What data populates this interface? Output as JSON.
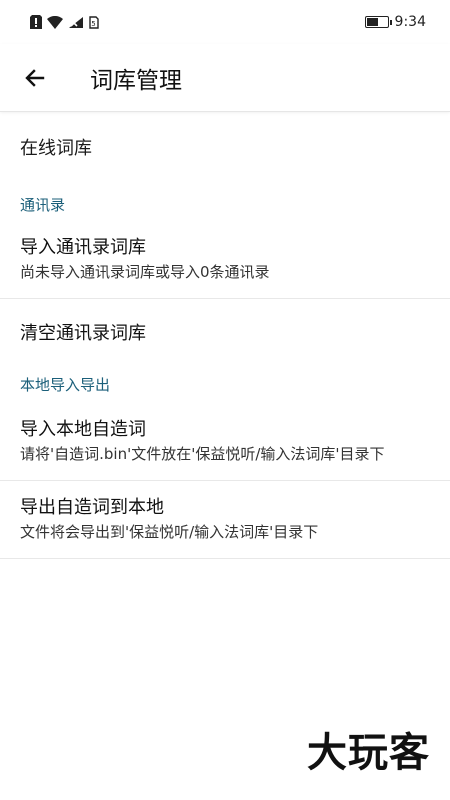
{
  "status_bar": {
    "left_icons": [
      "alert-icon",
      "wifi-icon",
      "signal-icon",
      "sim-icon"
    ],
    "time": "9:34"
  },
  "app_bar": {
    "title": "词库管理"
  },
  "online": {
    "label": "在线词库"
  },
  "contacts_section": {
    "header": "通讯录",
    "import": {
      "title": "导入通讯录词库",
      "subtitle": "尚未导入通讯录词库或导入0条通讯录"
    },
    "clear": {
      "title": "清空通讯录词库"
    }
  },
  "local_section": {
    "header": "本地导入导出",
    "import": {
      "title": "导入本地自造词",
      "subtitle": "请将'自造词.bin'文件放在'保益悦听/输入法词库'目录下"
    },
    "export": {
      "title": "导出自造词到本地",
      "subtitle": "文件将会导出到'保益悦听/输入法词库'目录下"
    }
  },
  "watermark": "大玩客",
  "colors": {
    "section_header": "#1b5f7a",
    "divider": "#e8e8e8"
  }
}
